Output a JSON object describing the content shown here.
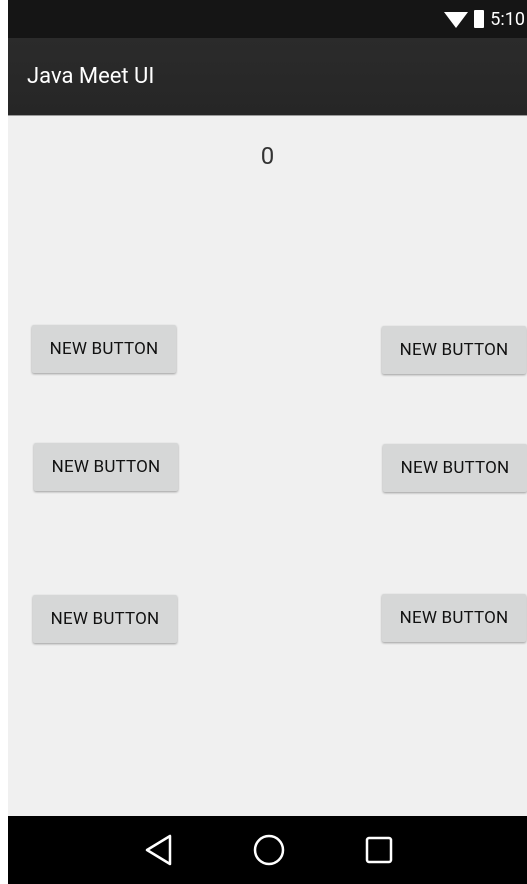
{
  "status_bar": {
    "time": "5:10"
  },
  "action_bar": {
    "title": "Java Meet UI"
  },
  "content": {
    "counter": "0",
    "buttons": [
      {
        "label": "NEW BUTTON"
      },
      {
        "label": "NEW BUTTON"
      },
      {
        "label": "NEW BUTTON"
      },
      {
        "label": "NEW BUTTON"
      },
      {
        "label": "NEW BUTTON"
      },
      {
        "label": "NEW BUTTON"
      }
    ]
  },
  "nav_bar": {
    "icons": [
      "back-icon",
      "home-icon",
      "recent-apps-icon"
    ]
  },
  "colors": {
    "status_bar_bg": "#151515",
    "action_bar_bg": "#282828",
    "content_bg": "#f0f0f0",
    "button_bg": "#d6d7d7",
    "nav_bar_bg": "#000000"
  }
}
